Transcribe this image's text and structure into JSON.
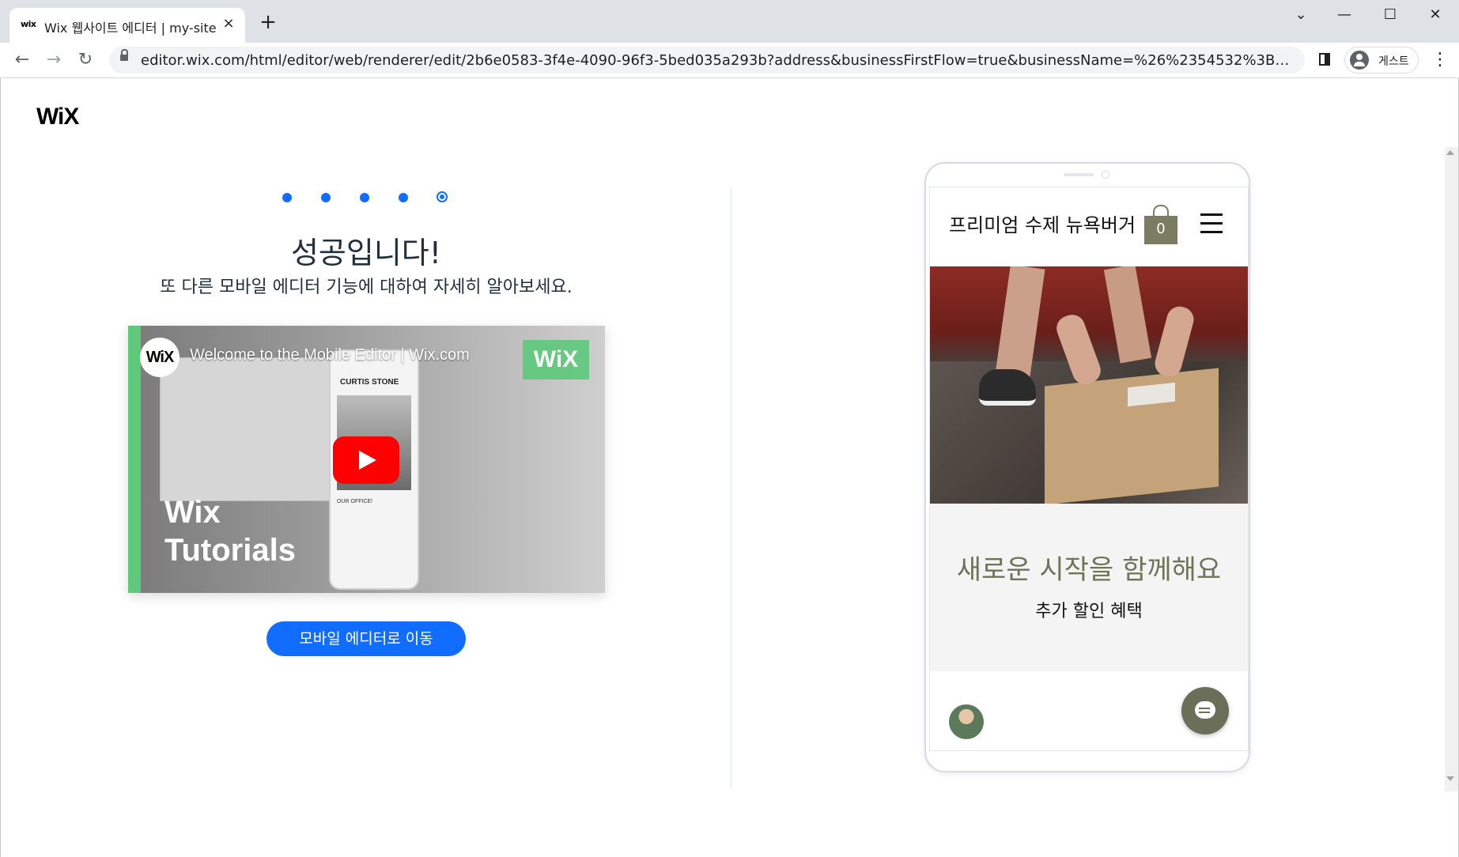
{
  "browser": {
    "tab": {
      "favicon": "wix",
      "title": "Wix 웹사이트 에디터 | my-site",
      "close_icon": "×"
    },
    "new_tab_icon": "+",
    "window_controls": {
      "dropdown": "⌄",
      "minimize": "—",
      "maximize": "☐",
      "close": "✕"
    },
    "nav": {
      "back": "←",
      "forward": "→",
      "reload": "↻"
    },
    "url": "editor.wix.com/html/editor/web/renderer/edit/2b6e0583-3f4e-4090-96f3-5bed035a293b?address&businessFirstFlow=true&businessName=%26%2354532%3B%26%2347532%3B%26...",
    "profile_label": "게스트",
    "menu_icon": "⋮"
  },
  "page": {
    "logo": "WiX",
    "steps": {
      "total": 5,
      "current": 5
    },
    "title": "성공입니다!",
    "subtitle": "또 다른 모바일 에디터 기능에 대하여 자세히 알아보세요.",
    "video": {
      "channel_logo": "WiX",
      "title": "Welcome to the Mobile Editor | Wix.com",
      "badge": "WiX",
      "overlay_line1": "Wix",
      "overlay_line2": "Tutorials",
      "phone_caption": "CURTIS STONE",
      "phone_lines": "OUR OFFICE!"
    },
    "cta_label": "모바일 에디터로 이동"
  },
  "preview": {
    "site_title": "프리미엄 수제 뉴욕버거",
    "cart_count": "0",
    "promo_title": "새로운 시작을 함께해요",
    "promo_sub": "추가 할인 혜택"
  },
  "colors": {
    "accent": "#116dff",
    "olive": "#6f7458",
    "bag": "#7a7d62"
  }
}
